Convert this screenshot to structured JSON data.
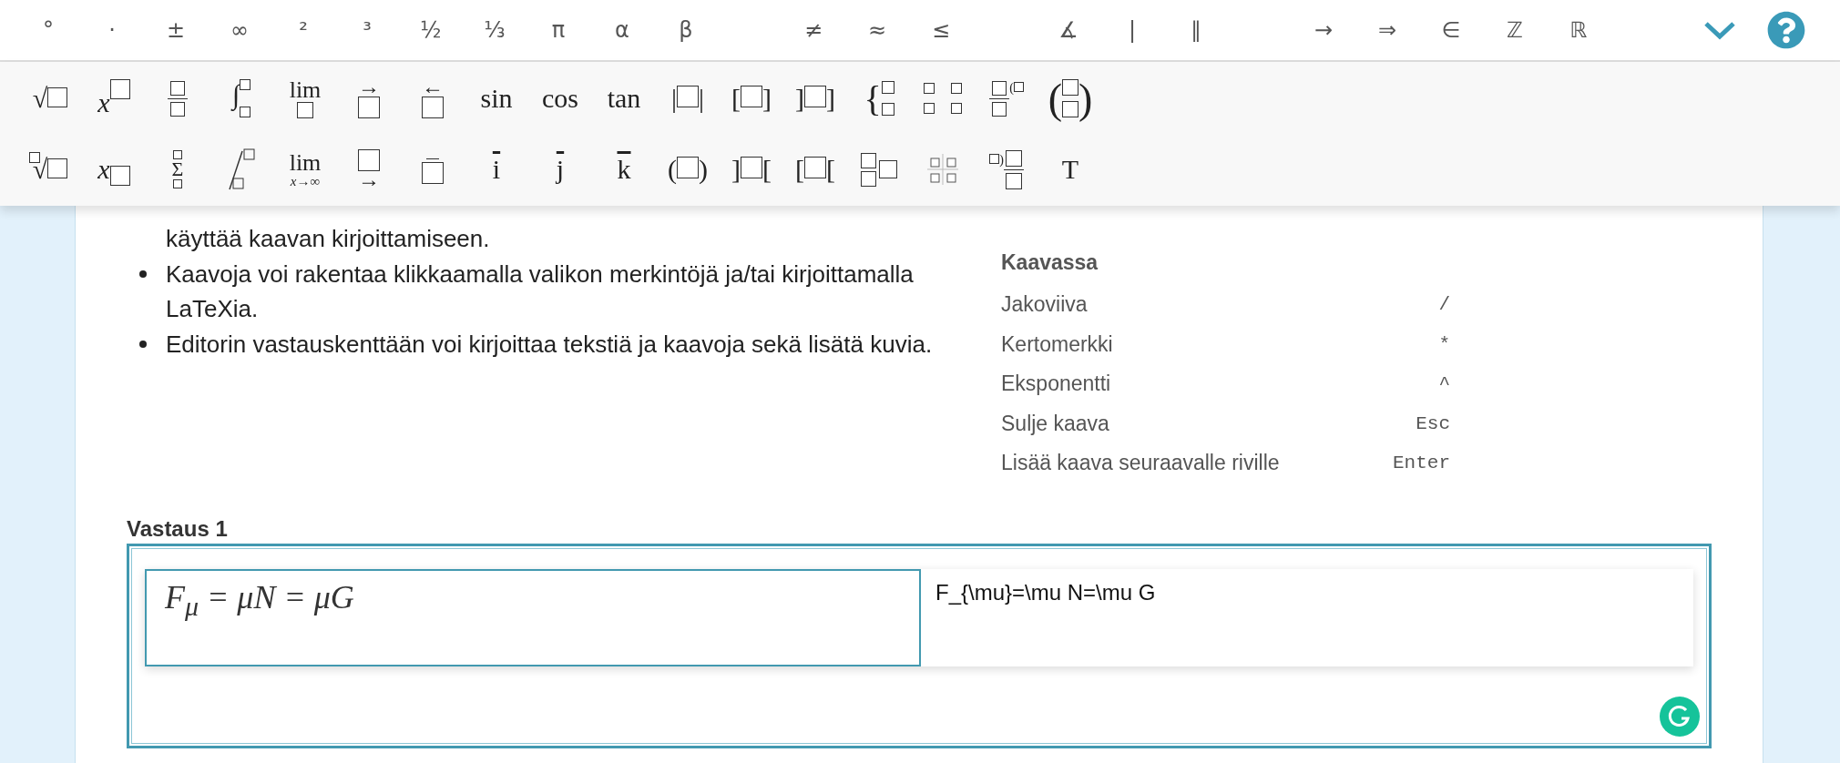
{
  "symbol_bar": {
    "groups": [
      [
        "°",
        "·",
        "±",
        "∞",
        "²",
        "³",
        "½",
        "⅓",
        "π",
        "α",
        "β"
      ],
      [
        "≠",
        "≈",
        "≤"
      ],
      [
        "∡",
        "|",
        "∥"
      ],
      [
        "→",
        "⇒",
        "∈",
        "ℤ",
        "ℝ"
      ]
    ]
  },
  "math_toolbar": {
    "rows": [
      [
        {
          "kind": "sqrt",
          "text": "√"
        },
        {
          "kind": "sup",
          "text": "x"
        },
        {
          "kind": "frac"
        },
        {
          "kind": "integral",
          "text": "∫"
        },
        {
          "kind": "lim",
          "text": "lim"
        },
        {
          "kind": "vec",
          "text": "→"
        },
        {
          "kind": "vec",
          "text": "←"
        },
        {
          "kind": "func",
          "text": "sin"
        },
        {
          "kind": "func",
          "text": "cos"
        },
        {
          "kind": "func",
          "text": "tan"
        },
        {
          "kind": "wrap",
          "text": "|",
          "end": "|"
        },
        {
          "kind": "wrap",
          "text": "[",
          "end": "]"
        },
        {
          "kind": "wrap",
          "text": "]",
          "end": "]"
        },
        {
          "kind": "cases",
          "text": "{"
        },
        {
          "kind": "matrix"
        },
        {
          "kind": "deriv",
          "text": "("
        },
        {
          "kind": "binom",
          "text": "(",
          "end": ")"
        }
      ],
      [
        {
          "kind": "nroot",
          "text": "√"
        },
        {
          "kind": "sub",
          "text": "x"
        },
        {
          "kind": "sum",
          "text": "Σ"
        },
        {
          "kind": "evalbar"
        },
        {
          "kind": "lim",
          "text": "lim",
          "sub": "x→∞"
        },
        {
          "kind": "overarrow",
          "text": "→"
        },
        {
          "kind": "overline"
        },
        {
          "kind": "hat",
          "text": "i"
        },
        {
          "kind": "hat",
          "text": "j"
        },
        {
          "kind": "hat",
          "text": "k"
        },
        {
          "kind": "wrap",
          "text": "(",
          "end": ")"
        },
        {
          "kind": "wrap",
          "text": "]",
          "end": "["
        },
        {
          "kind": "wrap",
          "text": "[",
          "end": "["
        },
        {
          "kind": "stack3"
        },
        {
          "kind": "grid4"
        },
        {
          "kind": "parenfrac",
          "text": ")"
        },
        {
          "kind": "func",
          "text": "T"
        }
      ]
    ]
  },
  "instructions": {
    "items": [
      {
        "text": "käyttää kaavan kirjoittamiseen.",
        "continued": true
      },
      {
        "text": "Kaavoja voi rakentaa klikkaamalla valikon merkintöjä ja/tai kirjoittamalla LaTeXia.",
        "continued": false
      },
      {
        "text": "Editorin vastauskenttään voi kirjoittaa tekstiä ja kaavoja sekä lisätä kuvia.",
        "continued": false
      }
    ]
  },
  "shortcuts": [
    {
      "kind": "heading",
      "label": "Kaavassa"
    },
    {
      "kind": "row",
      "label": "Jakoviiva",
      "key": "/"
    },
    {
      "kind": "row",
      "label": "Kertomerkki",
      "key": "*"
    },
    {
      "kind": "row",
      "label": "Eksponentti",
      "key": "^"
    },
    {
      "kind": "row",
      "label": "Sulje kaava",
      "key": "Esc"
    },
    {
      "kind": "row",
      "label": "Lisää kaava seuraavalle riville",
      "key": "Enter"
    }
  ],
  "answer": {
    "label": "Vastaus 1",
    "formula": "F$_{μ}$ = μN = μG",
    "latex": "F_{\\mu}=\\mu N=\\mu G"
  }
}
